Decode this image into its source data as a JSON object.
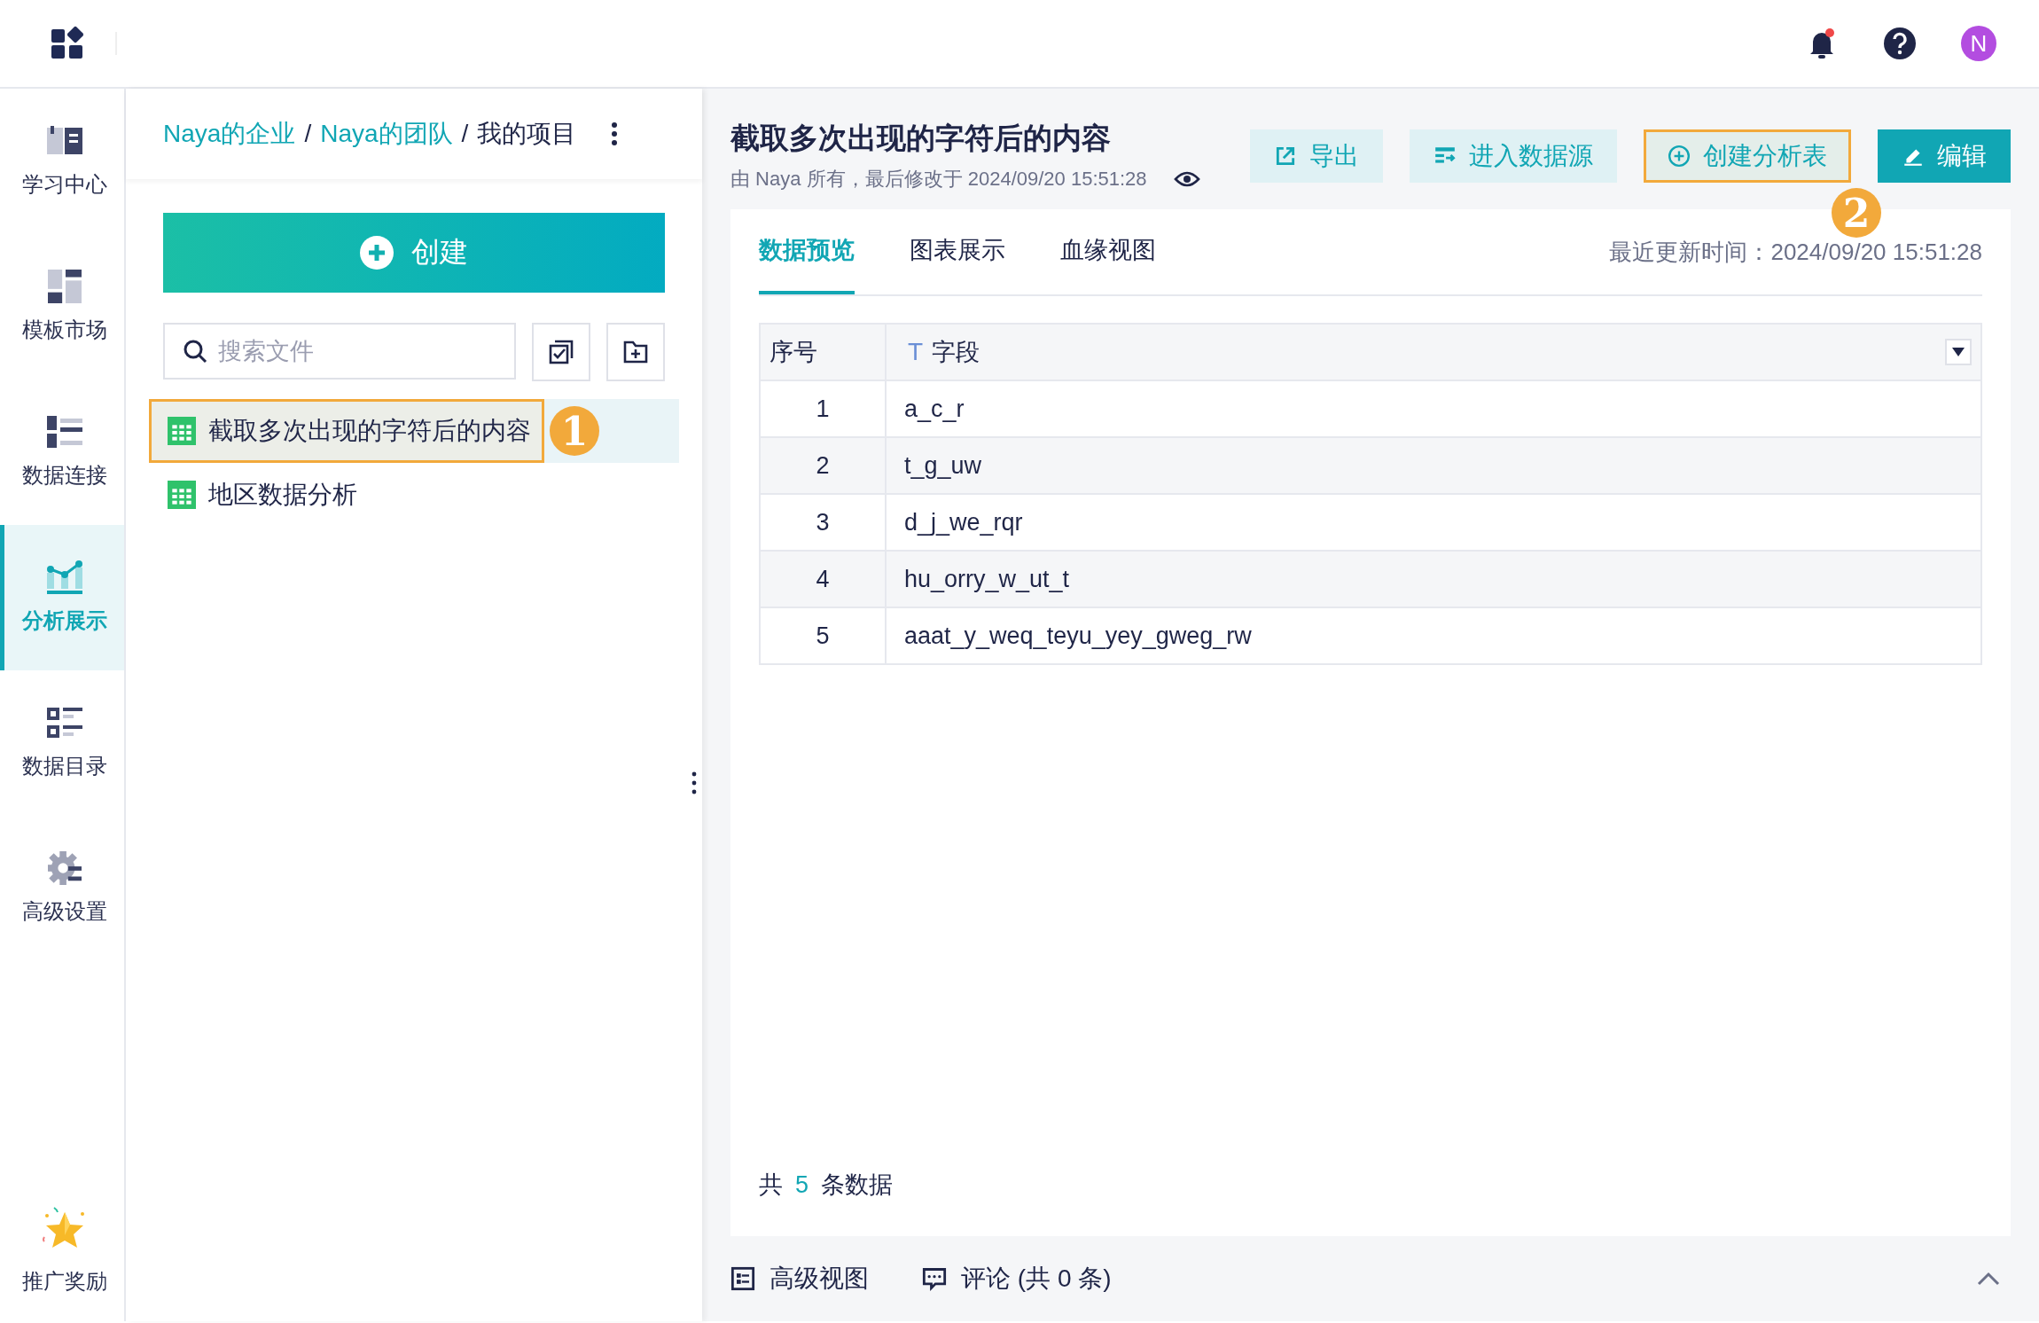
{
  "topbar": {
    "avatar": "N",
    "unread": true
  },
  "nav": [
    {
      "label": "学习中心",
      "kind": "book",
      "selected": false
    },
    {
      "label": "模板市场",
      "kind": "template",
      "selected": false
    },
    {
      "label": "数据连接",
      "kind": "connect",
      "selected": false
    },
    {
      "label": "分析展示",
      "kind": "chart",
      "selected": true
    },
    {
      "label": "数据目录",
      "kind": "catalog",
      "selected": false
    },
    {
      "label": "高级设置",
      "kind": "settings",
      "selected": false
    }
  ],
  "promo": {
    "label": "推广奖励"
  },
  "breadcrumbs": [
    {
      "label": "Naya的企业",
      "link": true
    },
    {
      "label": "Naya的团队",
      "link": true
    },
    {
      "label": "我的项目",
      "link": false
    }
  ],
  "breadcrumb_separator": "/",
  "create_button": "创建",
  "search": {
    "placeholder": "搜索文件"
  },
  "files": [
    {
      "name": "截取多次出现的字符后的内容",
      "selected": true,
      "highlighted": true,
      "callout": "1"
    },
    {
      "name": "地区数据分析",
      "selected": false,
      "highlighted": false
    }
  ],
  "document": {
    "title": "截取多次出现的字符后的内容",
    "meta": "由 Naya 所有，最后修改于 2024/09/20 15:51:28"
  },
  "actions": [
    {
      "label": "导出",
      "kind": "export",
      "highlighted": false
    },
    {
      "label": "进入数据源",
      "kind": "datasource",
      "highlighted": false
    },
    {
      "label": "创建分析表",
      "kind": "create",
      "highlighted": true,
      "callout": "2"
    },
    {
      "label": "编辑",
      "kind": "edit",
      "highlighted": false
    }
  ],
  "tabs": [
    {
      "label": "数据预览",
      "selected": true
    },
    {
      "label": "图表展示",
      "selected": false
    },
    {
      "label": "血缘视图",
      "selected": false
    }
  ],
  "updated": "最近更新时间：2024/09/20 15:51:28",
  "table": {
    "columns": [
      {
        "label": "序号"
      },
      {
        "label": "字段",
        "type_mark": "T"
      }
    ],
    "rows": [
      [
        "1",
        "a_c_r"
      ],
      [
        "2",
        "t_g_uw"
      ],
      [
        "3",
        "d_j_we_rqr"
      ],
      [
        "4",
        "hu_orry_w_ut_t"
      ],
      [
        "5",
        "aaat_y_weq_teyu_yey_gweg_rw"
      ]
    ]
  },
  "total": {
    "prefix": "共",
    "count": "5",
    "suffix": "条数据"
  },
  "bottom_bar": [
    {
      "label": "高级视图",
      "kind": "view"
    },
    {
      "label": "评论 (共 0 条)",
      "kind": "comment"
    }
  ]
}
